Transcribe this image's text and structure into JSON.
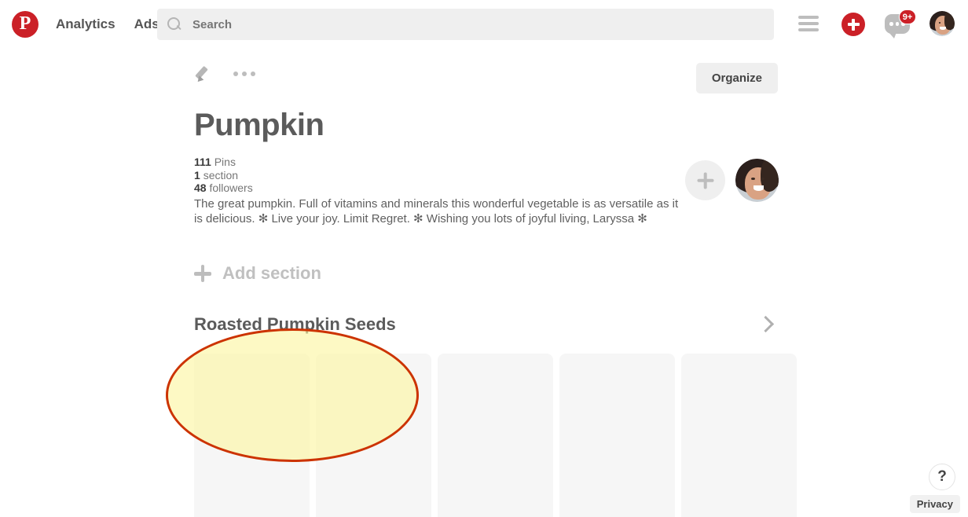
{
  "header": {
    "logo_icon": "pinterest-logo-icon",
    "logo_letter": "P",
    "nav": [
      {
        "label": "Analytics"
      },
      {
        "label": "Ads"
      }
    ],
    "search": {
      "icon": "search-icon",
      "placeholder": "Search",
      "value": ""
    },
    "menu_icon": "hamburger-menu-icon",
    "create_icon": "plus-icon",
    "messages_icon": "message-bubble-icon",
    "messages_badge": "9+",
    "avatar": "user-avatar"
  },
  "board": {
    "edit_icon": "pencil-icon",
    "more_icon": "ellipsis-icon",
    "organize_label": "Organize",
    "title": "Pumpkin",
    "stats": {
      "pins_count": "111",
      "pins_label": "Pins",
      "sections_count": "1",
      "sections_label": "section",
      "followers_count": "48",
      "followers_label": "followers"
    },
    "description": "The great pumpkin. Full of vitamins and minerals this wonderful vegetable is as versatile as it is delicious. ✻ Live your joy. Limit Regret. ✻ Wishing you lots of joyful living, Laryssa ✻",
    "invite_icon": "add-collaborator-icon",
    "owner_avatar": "board-owner-avatar",
    "add_section_label": "Add section",
    "add_section_icon": "plus-icon"
  },
  "section": {
    "title": "Roasted Pumpkin Seeds",
    "expand_icon": "chevron-right-icon",
    "pins": [
      {
        "name": "pin-placeholder-1"
      },
      {
        "name": "pin-placeholder-2"
      },
      {
        "name": "pin-placeholder-3"
      },
      {
        "name": "pin-placeholder-4"
      },
      {
        "name": "pin-placeholder-5"
      }
    ]
  },
  "annotation": {
    "shape": "ellipse-highlight",
    "stroke_color": "#cc3300",
    "fill_color": "#fcf6a0"
  },
  "footer": {
    "help_icon": "question-mark-icon",
    "help_label": "?",
    "privacy_label": "Privacy"
  },
  "colors": {
    "brand_red": "#cb2027",
    "search_bg": "#efefef",
    "card_bg": "#f6f6f6",
    "text_dark": "#5b5b5b",
    "text_muted": "#767676"
  }
}
